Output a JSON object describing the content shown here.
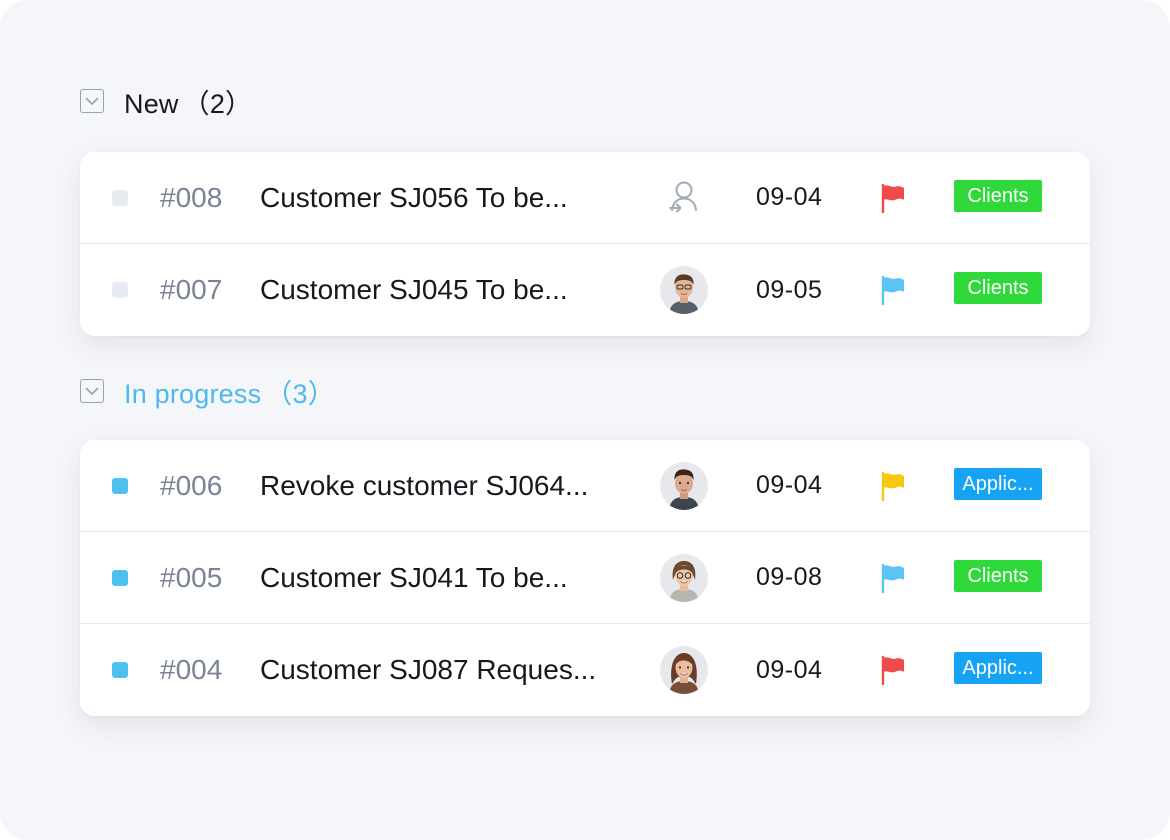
{
  "colors": {
    "panel_bg": "#f5f6fa",
    "accent_blue": "#4fb8ec",
    "flag_red": "#f04a4a",
    "flag_blue": "#5bc4f2",
    "flag_yellow": "#f8c80e",
    "tag_green": "#2fd93a",
    "tag_blue": "#16a2f5"
  },
  "groups": [
    {
      "title": "New",
      "count": "（2）",
      "collapse_icon": "chevron-down-box-icon",
      "rows": [
        {
          "id": "#008",
          "title": "Customer SJ056 To be...",
          "assignee": "unassigned-user-icon",
          "date": "09-04",
          "flag": "red",
          "tag": "Clients",
          "tag_type": "clients"
        },
        {
          "id": "#007",
          "title": "Customer SJ045 To be...",
          "assignee": "avatar-man-1",
          "date": "09-05",
          "flag": "blue",
          "tag": "Clients",
          "tag_type": "clients"
        }
      ]
    },
    {
      "title": "In progress",
      "count": "（3）",
      "collapse_icon": "chevron-down-box-icon",
      "rows": [
        {
          "id": "#006",
          "title": "Revoke customer SJ064...",
          "assignee": "avatar-man-2",
          "date": "09-04",
          "flag": "yellow",
          "tag": "Applic...",
          "tag_type": "applic"
        },
        {
          "id": "#005",
          "title": "Customer SJ041 To be...",
          "assignee": "avatar-woman-1",
          "date": "09-08",
          "flag": "blue",
          "tag": "Clients",
          "tag_type": "clients"
        },
        {
          "id": "#004",
          "title": "Customer SJ087 Reques...",
          "assignee": "avatar-woman-2",
          "date": "09-04",
          "flag": "red",
          "tag": "Applic...",
          "tag_type": "applic"
        }
      ]
    }
  ]
}
